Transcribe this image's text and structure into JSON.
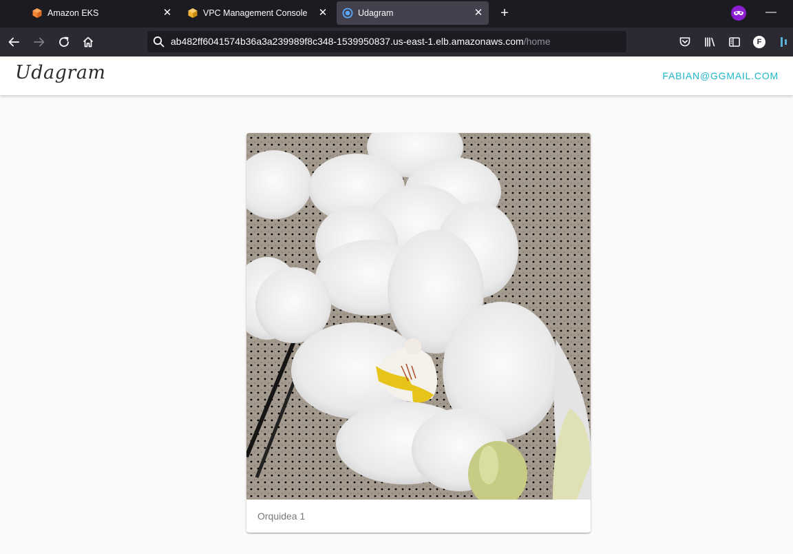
{
  "browser": {
    "tabs": [
      {
        "title": "Amazon EKS",
        "icon": "aws-eks-icon",
        "active": false
      },
      {
        "title": "VPC Management Console",
        "icon": "aws-vpc-icon",
        "active": false
      },
      {
        "title": "Udagram",
        "icon": "globe-loading-icon",
        "active": true
      }
    ],
    "url": {
      "host": "ab482ff6041574b36a3a239989f8c348-1539950837.us-east-1.elb.amazonaws.com",
      "path": "/home"
    },
    "profile_initial": "F"
  },
  "app": {
    "brand": "Udagram",
    "user_email": "FABIAN@GGMAIL.COM",
    "feed": [
      {
        "caption": "Orquidea 1",
        "image": "white-orchid-photo"
      }
    ]
  },
  "colors": {
    "accent": "#1eb7c9",
    "tabbar_bg": "#1c1b22",
    "toolbar_bg": "#2b2a33",
    "page_bg": "#fafafa"
  }
}
